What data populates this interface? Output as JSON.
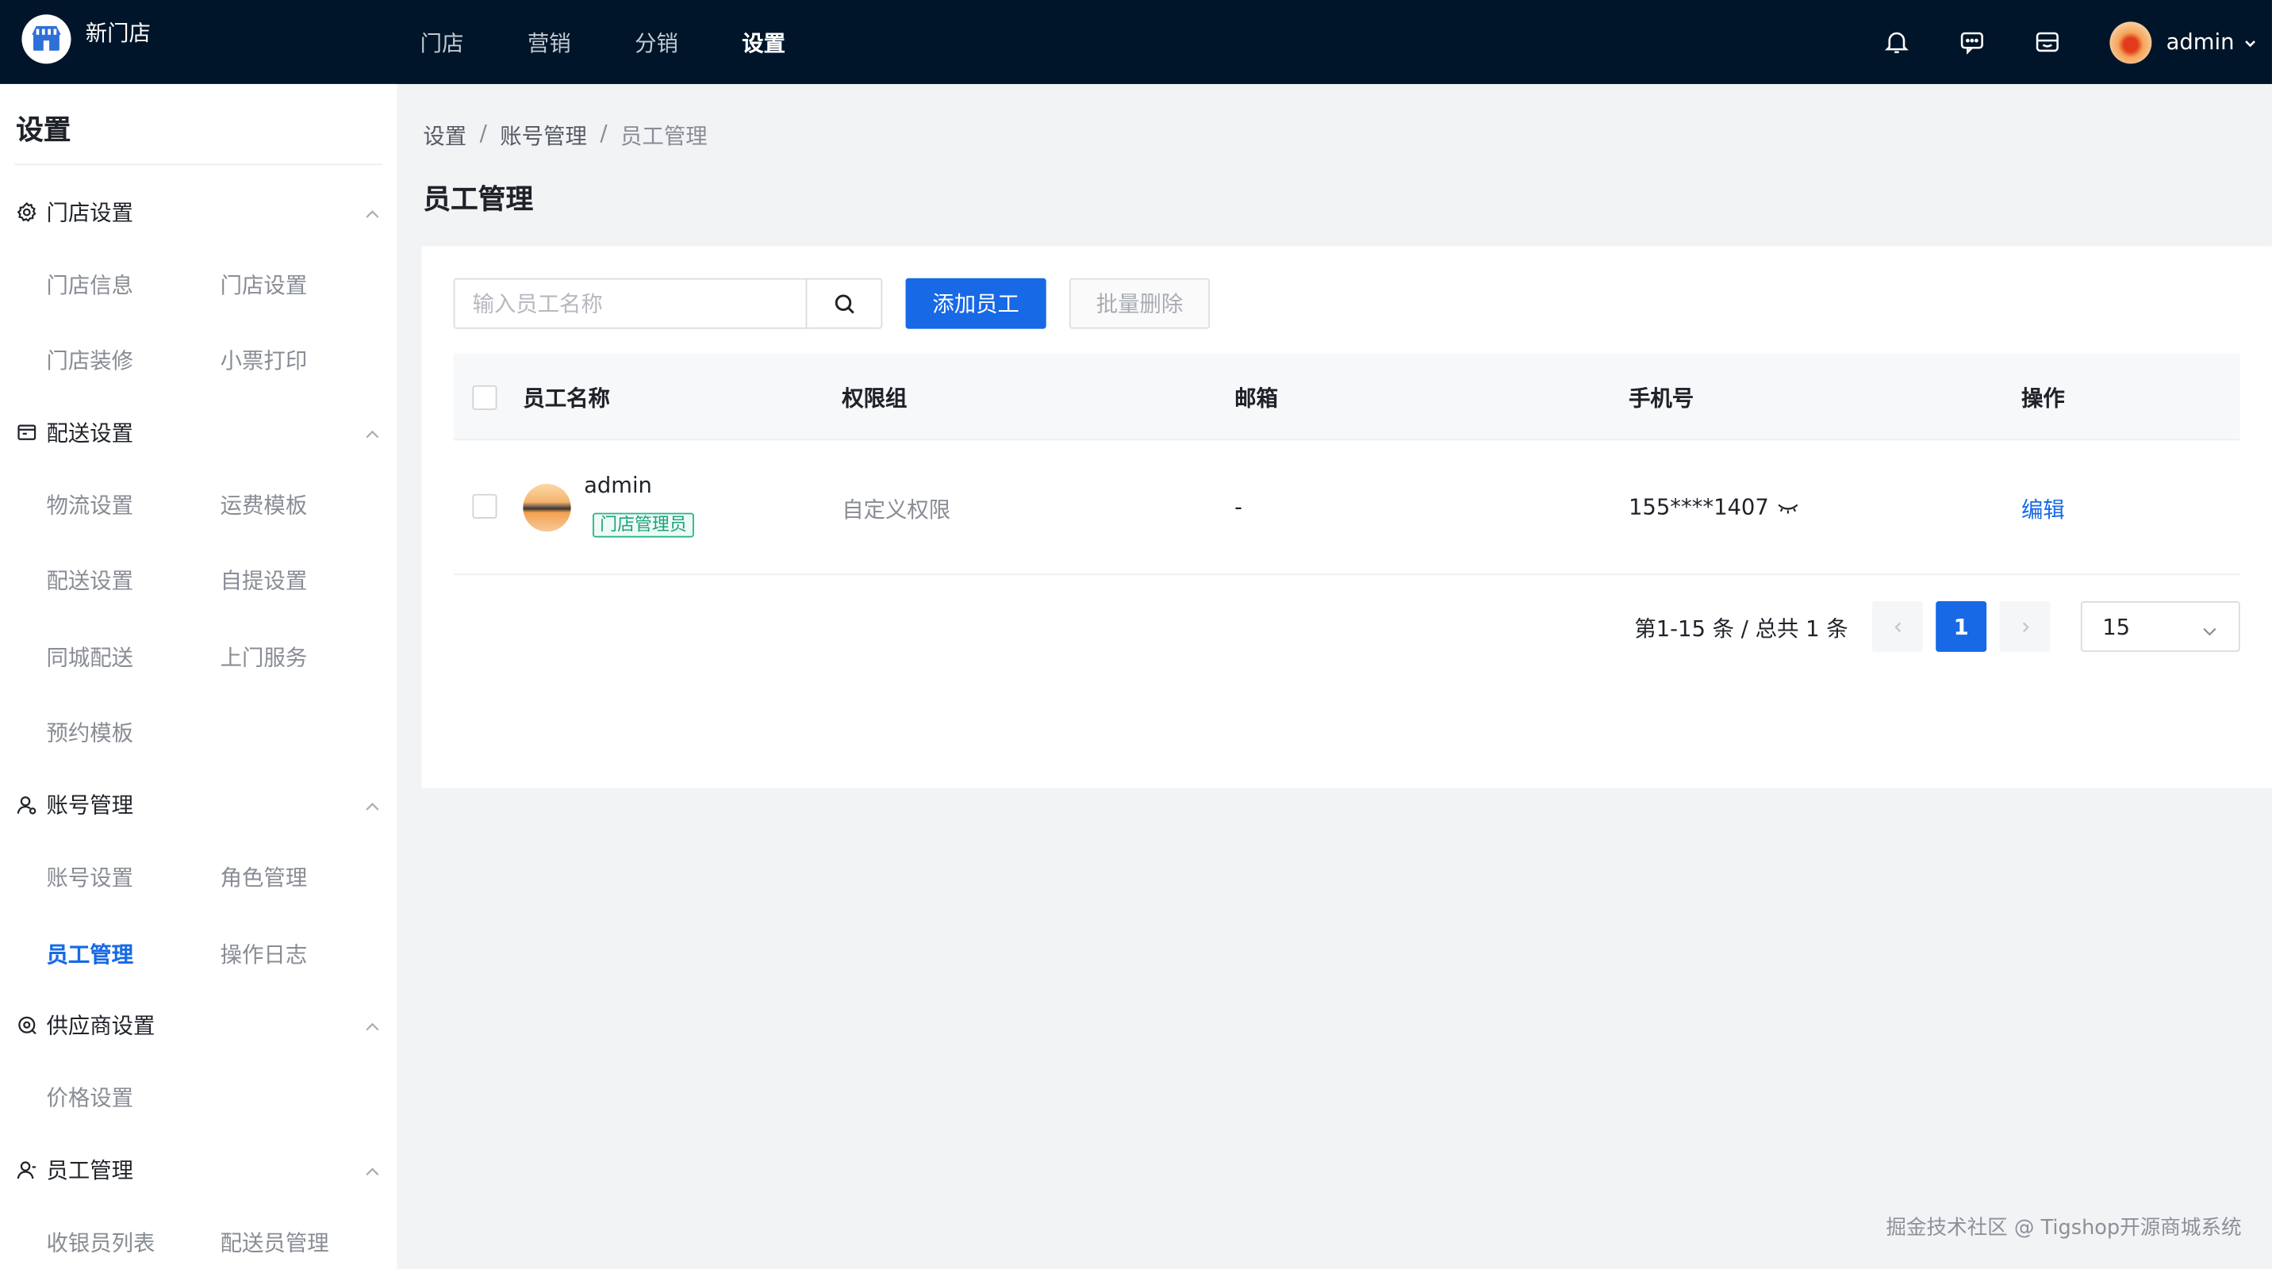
{
  "app": {
    "brand": "新门店",
    "nav": [
      {
        "label": "门店",
        "active": false
      },
      {
        "label": "营销",
        "active": false
      },
      {
        "label": "分销",
        "active": false
      },
      {
        "label": "设置",
        "active": true
      }
    ],
    "user": "admin"
  },
  "sidebar": {
    "title": "设置",
    "groups": [
      {
        "label": "门店设置",
        "icon": "gear-icon",
        "items": [
          "门店信息",
          "门店设置",
          "门店装修",
          "小票打印"
        ]
      },
      {
        "label": "配送设置",
        "icon": "box-icon",
        "items": [
          "物流设置",
          "运费模板",
          "配送设置",
          "自提设置",
          "同城配送",
          "上门服务",
          "预约模板"
        ]
      },
      {
        "label": "账号管理",
        "icon": "user-icon",
        "items": [
          "账号设置",
          "角色管理",
          "员工管理",
          "操作日志"
        ]
      },
      {
        "label": "供应商设置",
        "icon": "supplier-icon",
        "items": [
          "价格设置"
        ]
      },
      {
        "label": "员工管理",
        "icon": "person-icon",
        "items": [
          "收银员列表",
          "配送员管理"
        ]
      }
    ],
    "active_item": "员工管理"
  },
  "breadcrumb": [
    "设置",
    "账号管理",
    "员工管理"
  ],
  "page_title": "员工管理",
  "toolbar": {
    "search_placeholder": "输入员工名称",
    "add_label": "添加员工",
    "batch_delete_label": "批量删除"
  },
  "table": {
    "columns": [
      "员工名称",
      "权限组",
      "邮箱",
      "手机号",
      "操作"
    ],
    "rows": [
      {
        "name": "admin",
        "tag": "门店管理员",
        "permission": "自定义权限",
        "email": "-",
        "phone": "155****1407",
        "action": "编辑"
      }
    ]
  },
  "pagination": {
    "summary": "第1-15 条 / 总共 1 条",
    "current_page": "1",
    "page_size": "15"
  },
  "watermark": "掘金技术社区 @ Tigshop开源商城系统",
  "colors": {
    "topbar": "#001529",
    "primary": "#1769e6",
    "tag": "#19a37a"
  }
}
